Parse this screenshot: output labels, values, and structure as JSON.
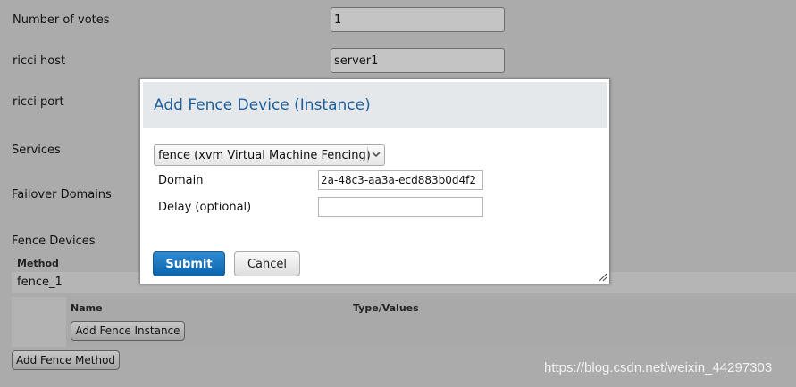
{
  "form": {
    "votes_label": "Number of votes",
    "votes_value": "1",
    "ricci_host_label": "ricci host",
    "ricci_host_value": "server1",
    "ricci_port_label": "ricci port",
    "services_label": "Services",
    "failover_label": "Failover Domains",
    "fence_devices_label": "Fence Devices"
  },
  "fence_table": {
    "method_header": "Method",
    "method_name": "fence_1",
    "name_header": "Name",
    "type_header": "Type/Values",
    "add_instance_label": "Add Fence Instance",
    "add_method_label": "Add Fence Method"
  },
  "modal": {
    "title": "Add Fence Device (Instance)",
    "device_select": "fence (xvm Virtual Machine Fencing)",
    "domain_label": "Domain",
    "domain_value": "2a-48c3-aa3a-ecd883b0d4f2",
    "delay_label": "Delay (optional)",
    "delay_value": "",
    "submit_label": "Submit",
    "cancel_label": "Cancel"
  },
  "watermark": "https://blog.csdn.net/weixin_44297303",
  "colors": {
    "overlay_bg": "#ababab",
    "title_blue": "#1f5f9c",
    "submit_blue": "#0c64ab"
  },
  "icons": {
    "select_arrow": "chevron-down-icon",
    "resize": "resize-grip-icon"
  }
}
